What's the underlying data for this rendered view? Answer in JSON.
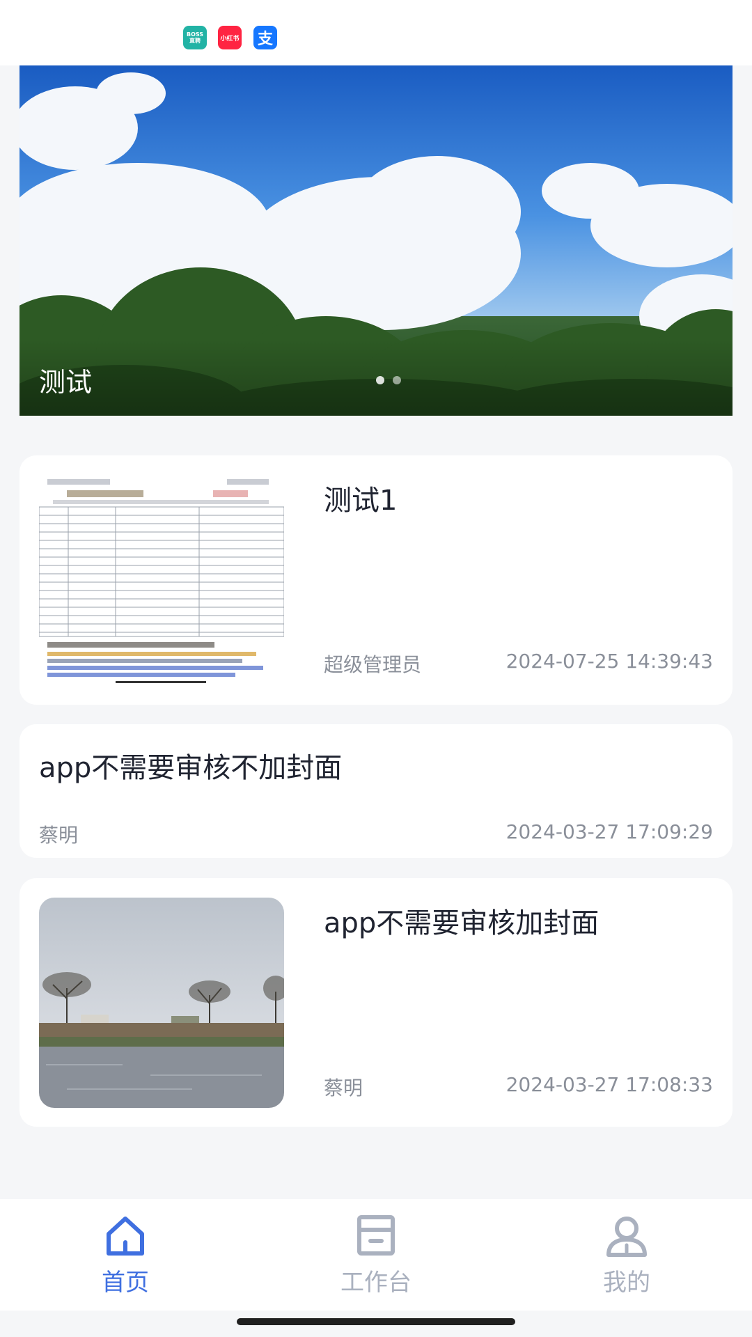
{
  "status_bar": {
    "apps": [
      {
        "name": "boss-zhipin",
        "label": "BOSS\n直聘",
        "color": "#22b3a5"
      },
      {
        "name": "xiaohongshu",
        "label": "小红书",
        "color": "#ff2442"
      },
      {
        "name": "alipay",
        "label": "支",
        "color": "#1677ff"
      }
    ]
  },
  "banner": {
    "caption": "测试",
    "slide_count": 2,
    "active_slide": 1
  },
  "articles": [
    {
      "title": "测试1",
      "author": "超级管理员",
      "date": "2024-07-25 14:39:43",
      "has_cover": true
    },
    {
      "title": "app不需要审核不加封面",
      "author": "蔡明",
      "date": "2024-03-27 17:09:29",
      "has_cover": false
    },
    {
      "title": "app不需要审核加封面",
      "author": "蔡明",
      "date": "2024-03-27 17:08:33",
      "has_cover": true
    }
  ],
  "tabbar": {
    "items": [
      {
        "label": "首页",
        "icon": "home-icon",
        "active": true
      },
      {
        "label": "工作台",
        "icon": "workbench-icon",
        "active": false
      },
      {
        "label": "我的",
        "icon": "profile-icon",
        "active": false
      }
    ],
    "active_color": "#3f6fe0",
    "inactive_color": "#aab1bf"
  }
}
